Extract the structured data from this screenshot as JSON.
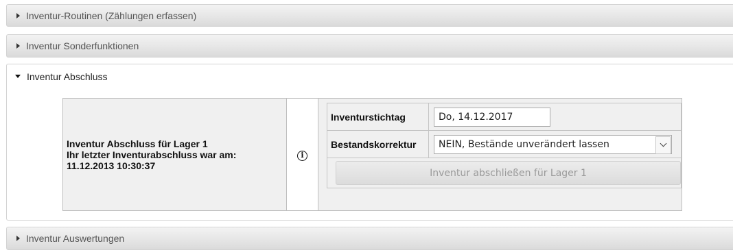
{
  "accordion": {
    "sections": [
      {
        "label": "Inventur-Routinen (Zählungen erfassen)",
        "expanded": false
      },
      {
        "label": "Inventur Sonderfunktionen",
        "expanded": false
      },
      {
        "label": "Inventur Abschluss",
        "expanded": true
      },
      {
        "label": "Inventur Auswertungen",
        "expanded": false
      }
    ]
  },
  "abschluss": {
    "info_line1": "Inventur Abschluss für Lager 1",
    "info_line2": "Ihr letzter Inventurabschluss war am:",
    "info_line3": "11.12.2013 10:30:37",
    "info_icon": "info-circle-icon",
    "stichtag_label": "Inventurstichtag",
    "stichtag_value": "Do, 14.12.2017",
    "korrektur_label": "Bestandskorrektur",
    "korrektur_selected": "NEIN, Bestände unverändert lassen",
    "submit_label": "Inventur abschließen für Lager 1"
  }
}
